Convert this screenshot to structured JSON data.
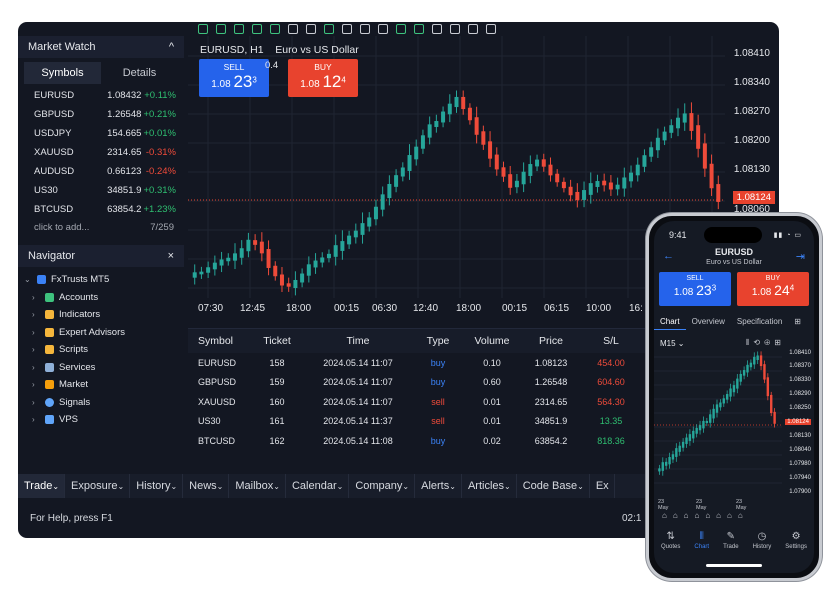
{
  "desktop": {
    "market_watch": {
      "title": "Market Watch",
      "tabs": [
        "Symbols",
        "Details"
      ],
      "rows": [
        {
          "symbol": "EURUSD",
          "price": "1.08432",
          "change": "+0.11%",
          "dir": "pos"
        },
        {
          "symbol": "GBPUSD",
          "price": "1.26548",
          "change": "+0.21%",
          "dir": "pos"
        },
        {
          "symbol": "USDJPY",
          "price": "154.665",
          "change": "+0.01%",
          "dir": "pos"
        },
        {
          "symbol": "XAUUSD",
          "price": "2314.65",
          "change": "-0.31%",
          "dir": "neg"
        },
        {
          "symbol": "AUDUSD",
          "price": "0.66123",
          "change": "-0.24%",
          "dir": "neg"
        },
        {
          "symbol": "US30",
          "price": "34851.9",
          "change": "+0.31%",
          "dir": "pos"
        },
        {
          "symbol": "BTCUSD",
          "price": "63854.2",
          "change": "+1.23%",
          "dir": "pos"
        }
      ],
      "add_label": "click to add...",
      "count": "7/259"
    },
    "navigator": {
      "title": "Navigator",
      "root": "FxTrusts MT5",
      "items": [
        "Accounts",
        "Indicators",
        "Expert Advisors",
        "Scripts",
        "Services",
        "Market",
        "Signals",
        "VPS"
      ]
    },
    "chart": {
      "symbol": "EURUSD, H1",
      "description": "Euro vs US Dollar",
      "sell_label": "SELL",
      "sell_prefix": "1.08",
      "sell_big": "23",
      "sell_sup": "3",
      "buy_label": "BUY",
      "buy_prefix": "1.08",
      "buy_big": "12",
      "buy_sup": "4",
      "spread": "0.4",
      "price_ticks": [
        "1.08410",
        "1.08340",
        "1.08270",
        "1.08200",
        "1.08130",
        "1.08060"
      ],
      "current_price": "1.08124",
      "time_ticks": [
        "07:30",
        "12:45",
        "18:00",
        "00:15",
        "06:30",
        "12:40",
        "18:00",
        "00:15",
        "06:15",
        "10:00",
        "16:"
      ]
    },
    "trade_table": {
      "headers": [
        "Symbol",
        "Ticket",
        "Time",
        "Type",
        "Volume",
        "Price",
        "S/L"
      ],
      "rows": [
        {
          "symbol": "EURUSD",
          "ticket": "158",
          "time": "2024.05.14 11:07",
          "type": "buy",
          "volume": "0.10",
          "price": "1.08123",
          "sl": "454.00",
          "sl_dir": "neg"
        },
        {
          "symbol": "GBPUSD",
          "ticket": "159",
          "time": "2024.05.14 11:07",
          "type": "buy",
          "volume": "0.60",
          "price": "1.26548",
          "sl": "604.60",
          "sl_dir": "neg"
        },
        {
          "symbol": "XAUUSD",
          "ticket": "160",
          "time": "2024.05.14 11:07",
          "type": "sell",
          "volume": "0.01",
          "price": "2314.65",
          "sl": "564.30",
          "sl_dir": "neg"
        },
        {
          "symbol": "US30",
          "ticket": "161",
          "time": "2024.05.14 11:37",
          "type": "sell",
          "volume": "0.01",
          "price": "34851.9",
          "sl": "13.35",
          "sl_dir": "pos"
        },
        {
          "symbol": "BTCUSD",
          "ticket": "162",
          "time": "2024.05.14 11:08",
          "type": "buy",
          "volume": "0.02",
          "price": "63854.2",
          "sl": "818.36",
          "sl_dir": "pos"
        }
      ]
    },
    "bottom_tabs": [
      "Trade",
      "Exposure",
      "History",
      "News",
      "Mailbox",
      "Calendar",
      "Company",
      "Alerts",
      "Articles",
      "Code Base",
      "Ex"
    ],
    "status_help": "For Help, press F1",
    "status_time": "02:1"
  },
  "phone": {
    "time": "9:41",
    "symbol": "EURUSD",
    "description": "Euro vs US Dollar",
    "sell_label": "SELL",
    "sell_prefix": "1.08",
    "sell_big": "23",
    "sell_sup": "3",
    "buy_label": "BUY",
    "buy_prefix": "1.08",
    "buy_big": "24",
    "buy_sup": "4",
    "tabs": [
      "Chart",
      "Overview",
      "Specification"
    ],
    "timeframe": "M15",
    "price_ticks": [
      "1.08410",
      "1.08370",
      "1.08330",
      "1.08290",
      "1.08250",
      "1.08124",
      "1.08130",
      "1.08040",
      "1.07980",
      "1.07940",
      "1.07900"
    ],
    "current_price": "1.08124",
    "dates": [
      "23 May",
      "23 May",
      "23 May"
    ],
    "nav": [
      "Quotes",
      "Chart",
      "Trade",
      "History",
      "Settings"
    ]
  },
  "colors": {
    "bg": "#131722",
    "up": "#26a69a",
    "down": "#ef4b3a",
    "sell": "#2563eb",
    "buy": "#e8432e"
  }
}
